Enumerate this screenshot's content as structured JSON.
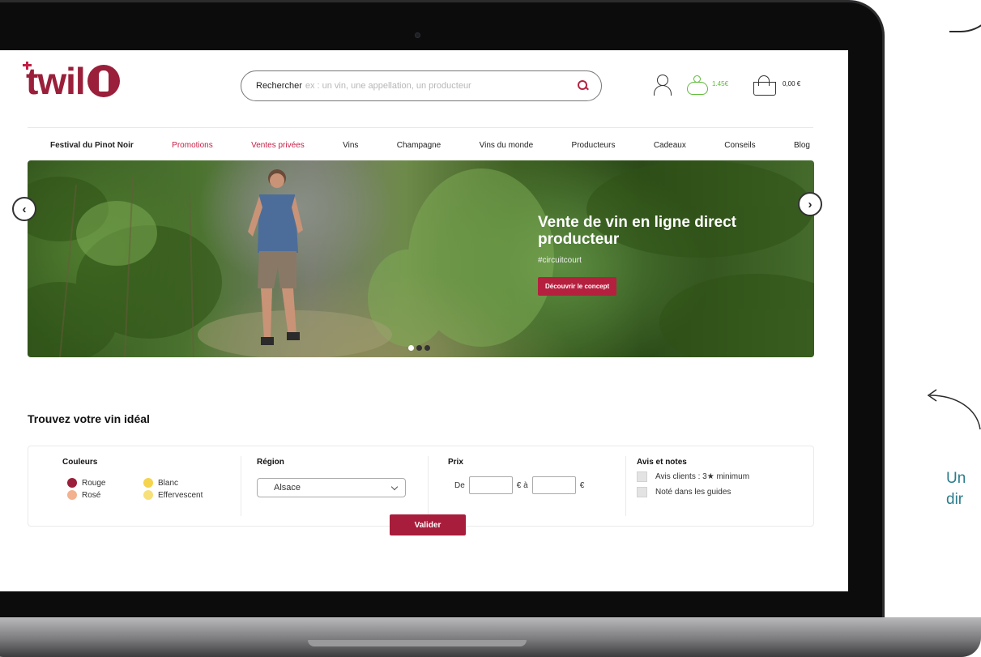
{
  "brand": {
    "logo_text": "twil",
    "accent_color": "#9a1f3a"
  },
  "search": {
    "label": "Rechercher",
    "placeholder": "ex : un vin, une appellation, un producteur",
    "icon": "search-icon"
  },
  "header": {
    "account_icon": "user-icon",
    "piggy_icon": "piggy-bank-icon",
    "piggy_value": "1.45€",
    "basket_icon": "basket-icon",
    "basket_value": "0,00 €"
  },
  "nav": {
    "items": [
      {
        "label": "Festival du Pinot Noir"
      },
      {
        "label": "Promotions"
      },
      {
        "label": "Ventes privées"
      },
      {
        "label": "Vins"
      },
      {
        "label": "Champagne"
      },
      {
        "label": "Vins du monde"
      },
      {
        "label": "Producteurs"
      },
      {
        "label": "Cadeaux"
      },
      {
        "label": "Conseils"
      },
      {
        "label": "Blog"
      }
    ]
  },
  "hero": {
    "title": "Vente de vin en ligne direct producteur",
    "tag": "#circuitcourt",
    "cta": "Découvrir le concept",
    "prev_label": "‹",
    "next_label": "›",
    "slide_count": 3,
    "active_slide": 1
  },
  "finder": {
    "title": "Trouvez votre vin idéal",
    "colors": {
      "title": "Couleurs",
      "options": [
        {
          "label": "Rouge",
          "color": "#9a1f3a"
        },
        {
          "label": "Blanc",
          "color": "#f5d44e"
        },
        {
          "label": "Rosé",
          "color": "#f3b18f"
        },
        {
          "label": "Effervescent",
          "color": "#f7e07a"
        }
      ]
    },
    "region": {
      "title": "Région",
      "selected": "Alsace"
    },
    "price": {
      "title": "Prix",
      "from": "De",
      "to": "€ à",
      "unit": "€"
    },
    "reviews": {
      "title": "Avis et notes",
      "options": [
        "Avis clients : 3★ minimum",
        "Noté dans les guides"
      ]
    },
    "submit": "Valider"
  },
  "side_note": {
    "line1": "Un",
    "line2": "dir"
  }
}
